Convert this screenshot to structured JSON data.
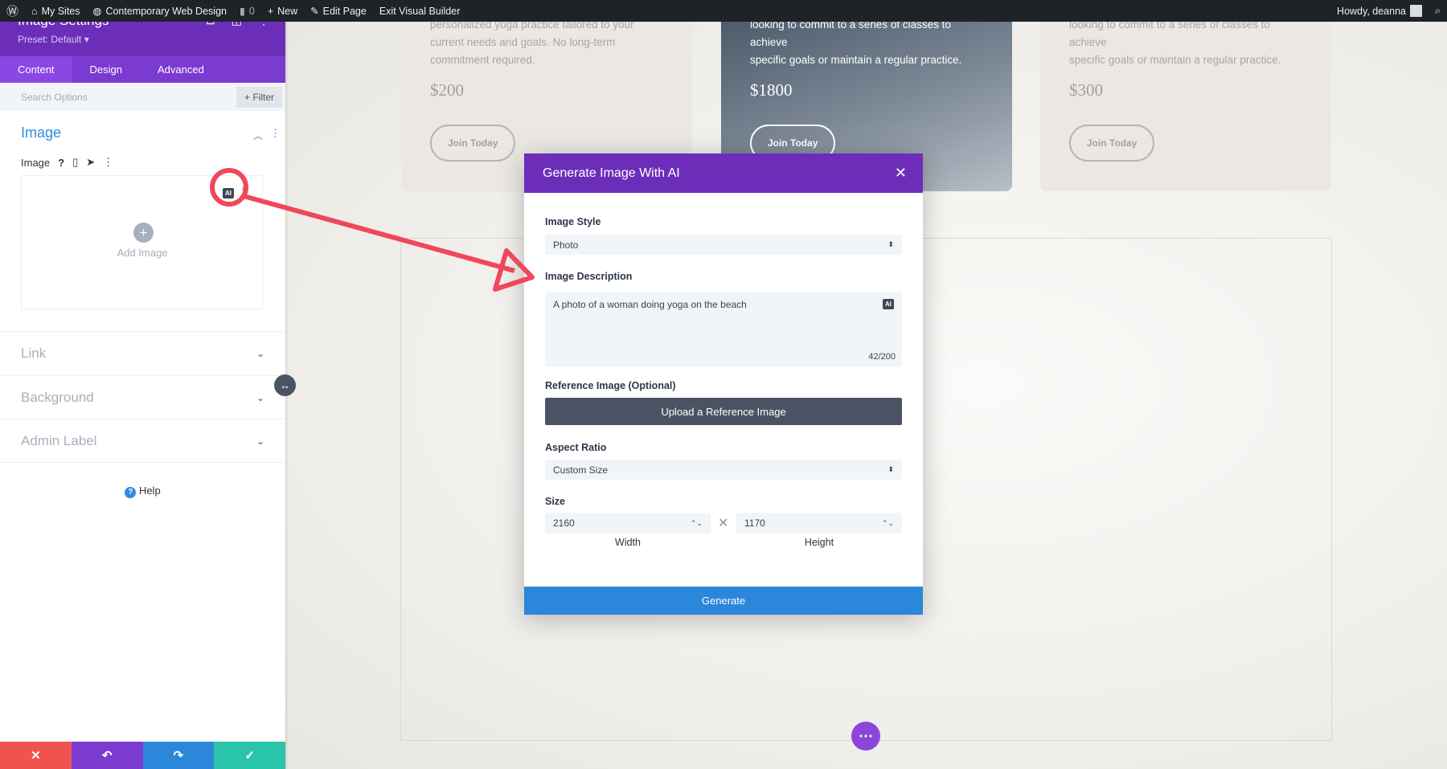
{
  "topbar": {
    "my_sites": "My Sites",
    "site": "Contemporary Web Design",
    "comments": "0",
    "new": "New",
    "edit": "Edit Page",
    "exit": "Exit Visual Builder",
    "howdy": "Howdy, deanna"
  },
  "sidebar": {
    "title": "Image Settings",
    "preset": "Preset: Default",
    "tabs": [
      "Content",
      "Design",
      "Advanced"
    ],
    "search_placeholder": "Search Options",
    "filter": "Filter",
    "section": "Image",
    "field_label": "Image",
    "add_image": "Add Image",
    "ai_badge": "AI",
    "toggles": [
      "Link",
      "Background",
      "Admin Label"
    ],
    "help": "Help"
  },
  "cards": [
    {
      "lines": [
        "personalized yoga practice tailored to your",
        "current needs and goals. No long-term",
        "commitment required."
      ],
      "price": "$200",
      "button": "Join Today"
    },
    {
      "lines": [
        "looking to commit to a series of classes to achieve",
        "specific goals or maintain a regular practice."
      ],
      "price": "$1800",
      "button": "Join Today"
    },
    {
      "lines": [
        "looking to commit to a series of classes to achieve",
        "specific goals or maintain a regular practice."
      ],
      "price": "$300",
      "button": "Join Today"
    }
  ],
  "modal": {
    "title": "Generate Image With AI",
    "style_label": "Image Style",
    "style_value": "Photo",
    "desc_label": "Image Description",
    "desc_value": "A photo of a woman doing yoga on the beach",
    "ai_badge": "AI",
    "char_count": "42/200",
    "ref_label": "Reference Image (Optional)",
    "upload": "Upload a Reference Image",
    "aspect_label": "Aspect Ratio",
    "aspect_value": "Custom Size",
    "size_label": "Size",
    "width": "2160",
    "height": "1170",
    "width_label": "Width",
    "height_label": "Height",
    "generate": "Generate"
  },
  "colors": {
    "purple": "#6c2eb9",
    "blue": "#2b87da",
    "annotation": "#f0475a"
  }
}
